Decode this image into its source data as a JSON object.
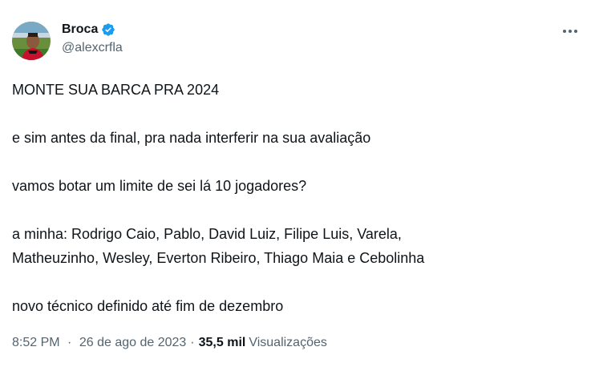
{
  "author": {
    "display_name": "Broca",
    "handle": "@alexcrfla",
    "verified": true
  },
  "icons": {
    "verified": "verified-badge-icon",
    "more": "more-options-icon"
  },
  "colors": {
    "verified_blue": "#1d9bf0",
    "secondary_text": "#536471",
    "primary_text": "#0f1419"
  },
  "tweet": {
    "lines": [
      "MONTE SUA BARCA PRA 2024",
      "e sim antes da final, pra nada interferir na sua avaliação",
      "vamos botar um limite de sei lá 10 jogadores?",
      "a minha: Rodrigo Caio, Pablo, David Luiz, Filipe Luis, Varela,",
      "Matheuzinho, Wesley, Everton Ribeiro, Thiago Maia e Cebolinha",
      "novo técnico definido até fim de dezembro"
    ]
  },
  "meta": {
    "time": "8:52 PM",
    "date": "26 de ago de 2023",
    "separator": "·",
    "views_count": "35,5 mil",
    "views_label": "Visualizações"
  }
}
